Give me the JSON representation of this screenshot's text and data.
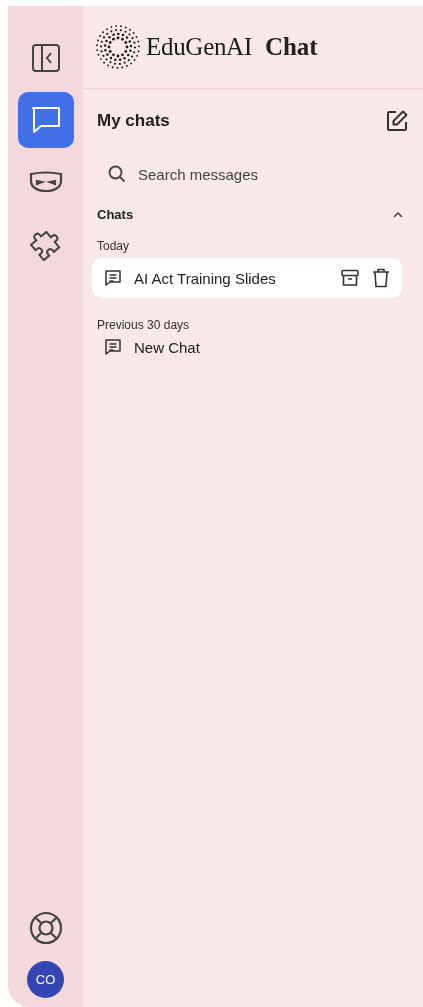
{
  "rail": {
    "items": [
      {
        "kind": "toggle",
        "selected": false
      },
      {
        "kind": "chat",
        "selected": true
      },
      {
        "kind": "mask",
        "selected": false
      },
      {
        "kind": "puzzle",
        "selected": false
      }
    ],
    "help": {
      "kind": "lifebuoy"
    },
    "avatar": {
      "initials": "CO"
    }
  },
  "brand": {
    "name": "EduGenAI",
    "product": "Chat"
  },
  "panel": {
    "title": "My chats",
    "search": {
      "placeholder": "Search messages"
    },
    "section": {
      "title": "Chats",
      "expanded": true,
      "groups": [
        {
          "label": "Today",
          "items": [
            {
              "title": "AI Act Training Slides",
              "selected": true
            }
          ]
        },
        {
          "label": "Previous 30 days",
          "items": [
            {
              "title": "New Chat",
              "selected": false
            }
          ]
        }
      ]
    }
  }
}
